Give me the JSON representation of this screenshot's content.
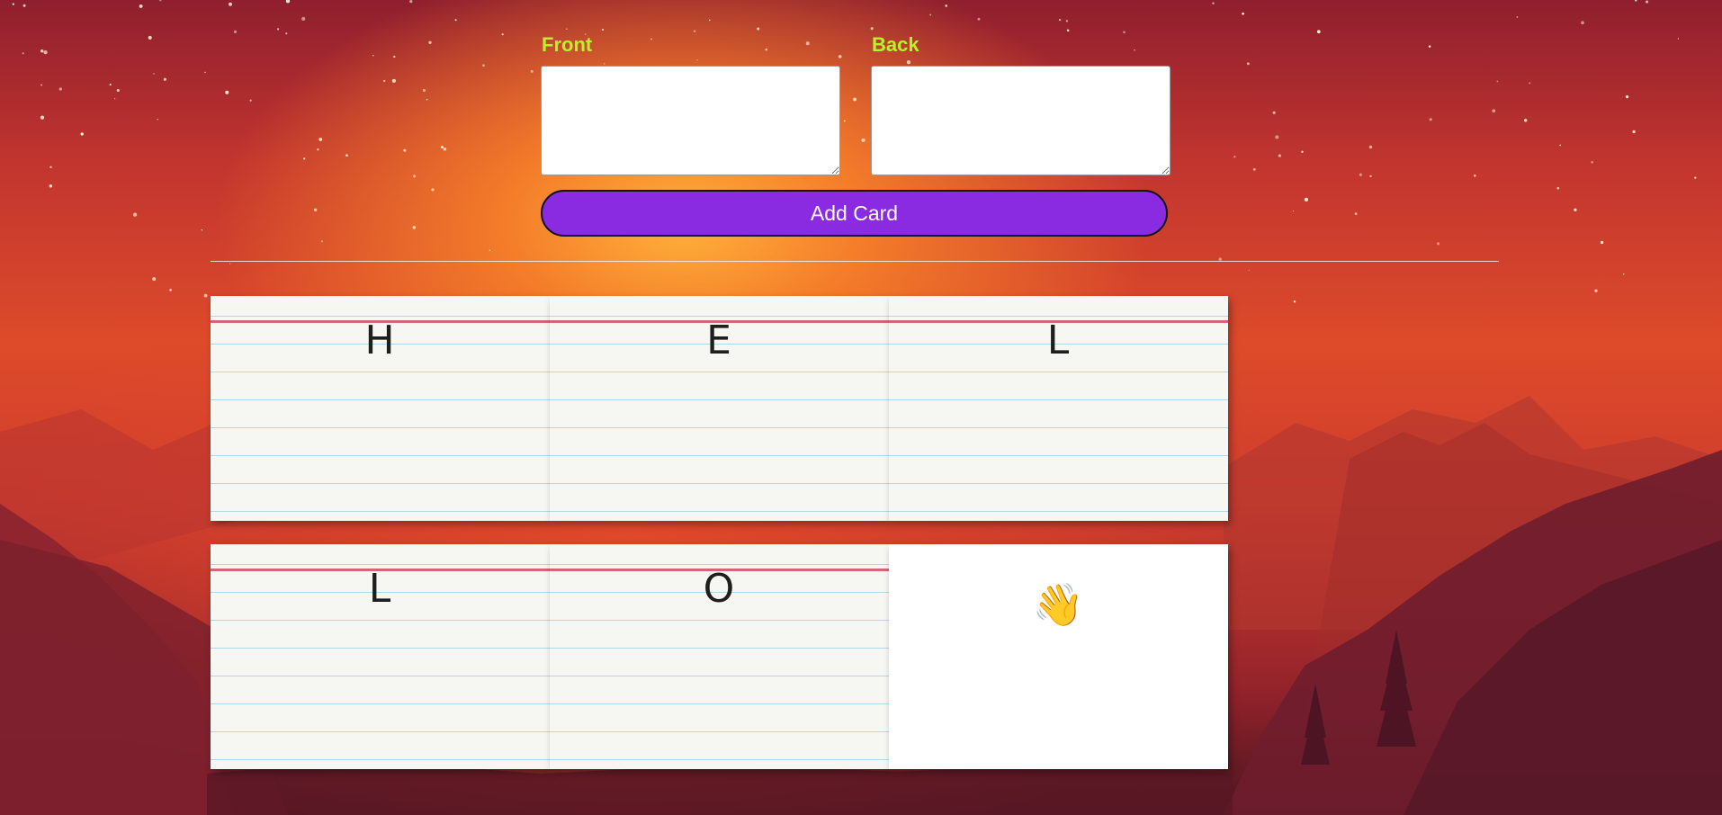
{
  "form": {
    "front_label": "Front",
    "back_label": "Back",
    "front_value": "",
    "back_value": "",
    "add_button_label": "Add Card"
  },
  "cards": [
    {
      "front": "H",
      "style": "lined"
    },
    {
      "front": "E",
      "style": "lined"
    },
    {
      "front": "L",
      "style": "lined"
    },
    {
      "front": "L",
      "style": "lined"
    },
    {
      "front": "O",
      "style": "lined"
    },
    {
      "front": "👋",
      "style": "blank",
      "icon": "waving-hand-icon"
    }
  ],
  "colors": {
    "label": "#b8f22b",
    "button": "#8a2be2",
    "card_margin_line": "#d06479",
    "card_rule_line": "#a9d2e6"
  }
}
